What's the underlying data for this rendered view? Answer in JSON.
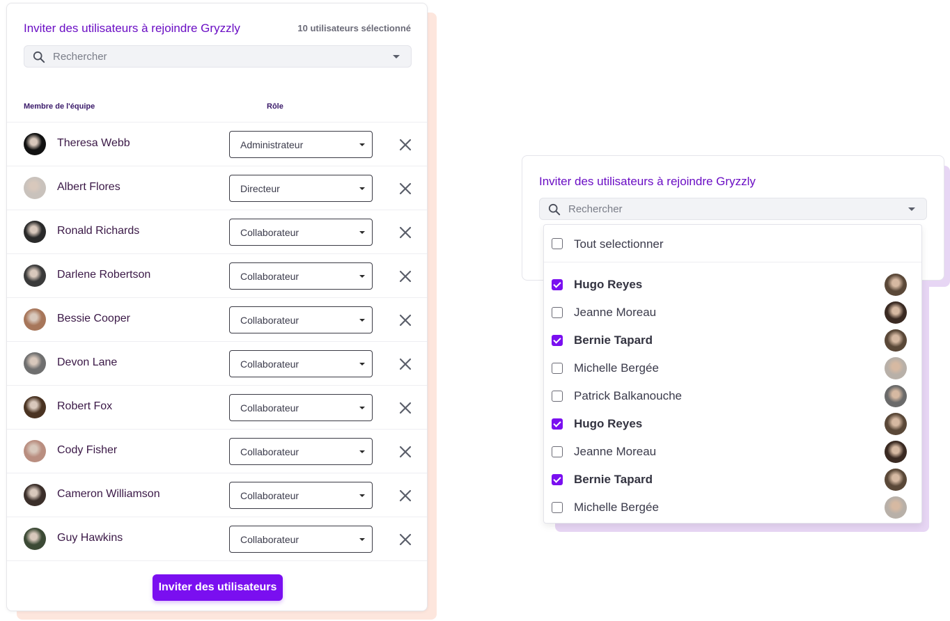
{
  "invite_panel": {
    "title": "Inviter des utilisateurs à rejoindre Gryzzly",
    "selected_count": "10 utilisateurs sélectionné",
    "search_placeholder": "Rechercher",
    "columns": {
      "member": "Membre de l'équipe",
      "role": "Rôle"
    },
    "members": [
      {
        "name": "Theresa Webb",
        "role": "Administrateur",
        "avatar_bg": "#111111"
      },
      {
        "name": "Albert Flores",
        "role": "Directeur",
        "avatar_bg": "#c9c2bc"
      },
      {
        "name": "Ronald Richards",
        "role": "Collaborateur",
        "avatar_bg": "#2a2a2a"
      },
      {
        "name": "Darlene Robertson",
        "role": "Collaborateur",
        "avatar_bg": "#3a3a3a"
      },
      {
        "name": "Bessie Cooper",
        "role": "Collaborateur",
        "avatar_bg": "#a7765a"
      },
      {
        "name": "Devon Lane",
        "role": "Collaborateur",
        "avatar_bg": "#6f6f6f"
      },
      {
        "name": "Robert Fox",
        "role": "Collaborateur",
        "avatar_bg": "#4a3322"
      },
      {
        "name": "Cody Fisher",
        "role": "Collaborateur",
        "avatar_bg": "#b98e80"
      },
      {
        "name": "Cameron Williamson",
        "role": "Collaborateur",
        "avatar_bg": "#3b2f2a"
      },
      {
        "name": "Guy Hawkins",
        "role": "Collaborateur",
        "avatar_bg": "#3c4a35"
      }
    ],
    "invite_button": "Inviter des utilisateurs"
  },
  "select_panel": {
    "title": "Inviter des utilisateurs à rejoindre Gryzzly",
    "search_placeholder": "Rechercher",
    "select_all_label": "Tout selectionner",
    "users": [
      {
        "name": "Hugo Reyes",
        "checked": true,
        "avatar_bg": "#5a4838"
      },
      {
        "name": "Jeanne Moreau",
        "checked": false,
        "avatar_bg": "#3a2a22"
      },
      {
        "name": "Bernie Tapard",
        "checked": true,
        "avatar_bg": "#5a4838"
      },
      {
        "name": "Michelle Bergée",
        "checked": false,
        "avatar_bg": "#b8b0a8"
      },
      {
        "name": "Patrick Balkanouche",
        "checked": false,
        "avatar_bg": "#6a6a6a"
      },
      {
        "name": "Hugo Reyes",
        "checked": true,
        "avatar_bg": "#5a4838"
      },
      {
        "name": "Jeanne Moreau",
        "checked": false,
        "avatar_bg": "#3a2a22"
      },
      {
        "name": "Bernie Tapard",
        "checked": true,
        "avatar_bg": "#5a4838"
      },
      {
        "name": "Michelle Bergée",
        "checked": false,
        "avatar_bg": "#b8b0a8"
      }
    ]
  },
  "colors": {
    "accent": "#7a0ff0",
    "title": "#6a0dc4",
    "left_shadow": "#fde6dd",
    "right_shadow": "#e7d6f4"
  }
}
